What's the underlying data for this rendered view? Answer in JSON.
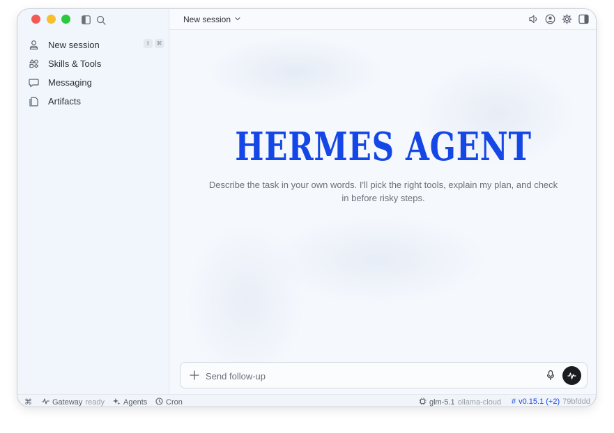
{
  "sidebar": {
    "items": [
      {
        "label": "New session",
        "icon": "person-icon"
      },
      {
        "label": "Skills & Tools",
        "icon": "shapes-icon"
      },
      {
        "label": "Messaging",
        "icon": "chat-icon"
      },
      {
        "label": "Artifacts",
        "icon": "files-icon"
      }
    ],
    "shortcut_keys": [
      "⇧",
      "⌘"
    ]
  },
  "header": {
    "session_title": "New session"
  },
  "hero": {
    "title": "HERMES AGENT",
    "description": "Describe the task in your own words. I'll pick the right tools, explain my plan, and check in before risky steps.",
    "accent_color": "#1447e6"
  },
  "composer": {
    "placeholder": "Send follow-up"
  },
  "statusbar": {
    "command_glyph": "⌘",
    "gateway_label": "Gateway",
    "gateway_status": "ready",
    "agents_label": "Agents",
    "cron_label": "Cron",
    "model_name": "glm-5.1",
    "model_provider": "ollama-cloud",
    "version_hash_symbol": "#",
    "version": "v0.15.1 (+2)",
    "commit": "79bfddd"
  }
}
